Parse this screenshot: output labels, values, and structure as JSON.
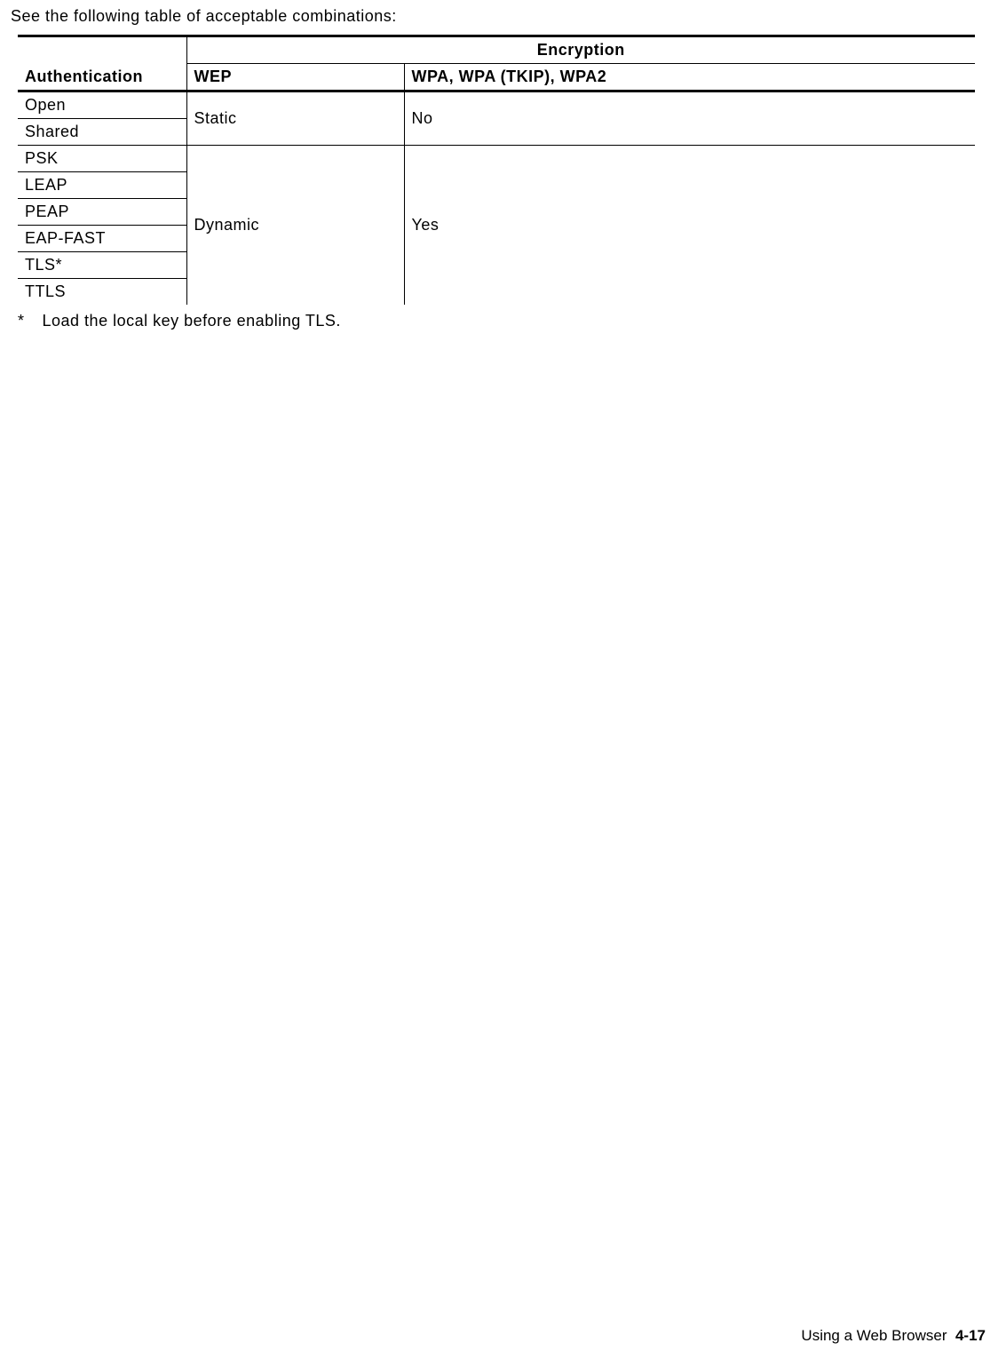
{
  "intro": "See the following table of acceptable combinations:",
  "headers": {
    "authentication": "Authentication",
    "encryption": "Encryption",
    "wep": "WEP",
    "wpa": "WPA, WPA (TKIP), WPA2"
  },
  "group1": {
    "rows": [
      "Open",
      "Shared"
    ],
    "wep": "Static",
    "wpa": "No"
  },
  "group2": {
    "rows": [
      "PSK",
      "LEAP",
      "PEAP",
      "EAP-FAST",
      "TLS*",
      "TTLS"
    ],
    "wep": "Dynamic",
    "wpa": "Yes"
  },
  "footnote": {
    "mark": "*",
    "text": "Load the local key before enabling TLS."
  },
  "footer": {
    "section": "Using a Web Browser",
    "page": "4-17"
  }
}
